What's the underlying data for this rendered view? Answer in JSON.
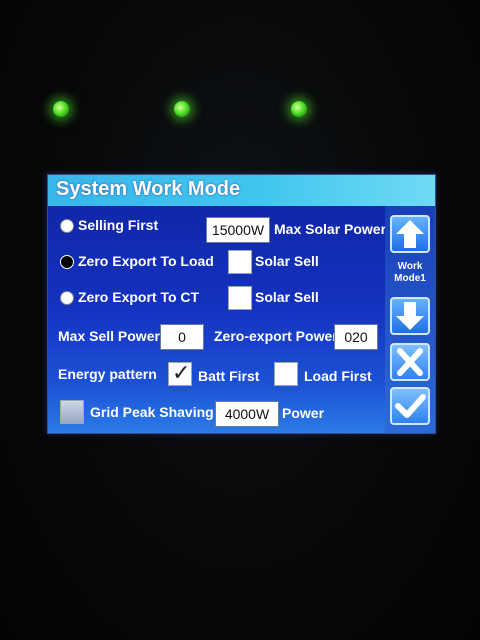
{
  "title": "System Work Mode",
  "modes": {
    "selling_first": "Selling First",
    "zero_export_load": "Zero Export To Load",
    "zero_export_ct": "Zero Export To CT"
  },
  "max_solar_power": {
    "value": "15000W",
    "label": "Max Solar Power"
  },
  "solar_sell_1": "Solar Sell",
  "solar_sell_2": "Solar Sell",
  "max_sell_power": {
    "label": "Max Sell Power",
    "value": "0"
  },
  "zero_export_power": {
    "label": "Zero-export Power",
    "value": "020"
  },
  "energy_pattern": {
    "label": "Energy pattern",
    "batt_first": "Batt First",
    "load_first": "Load First"
  },
  "grid_peak_shaving": {
    "label": "Grid Peak Shaving",
    "value": "4000W",
    "unit": "Power"
  },
  "sidebar": {
    "mode_line1": "Work",
    "mode_line2": "Mode1"
  },
  "icons": {
    "up": "arrow-up-icon",
    "down": "arrow-down-icon",
    "cancel": "close-icon",
    "confirm": "check-icon"
  },
  "colors": {
    "title_bar": "#41c6ee",
    "panel": "#1432c0",
    "led": "#4ee028"
  }
}
